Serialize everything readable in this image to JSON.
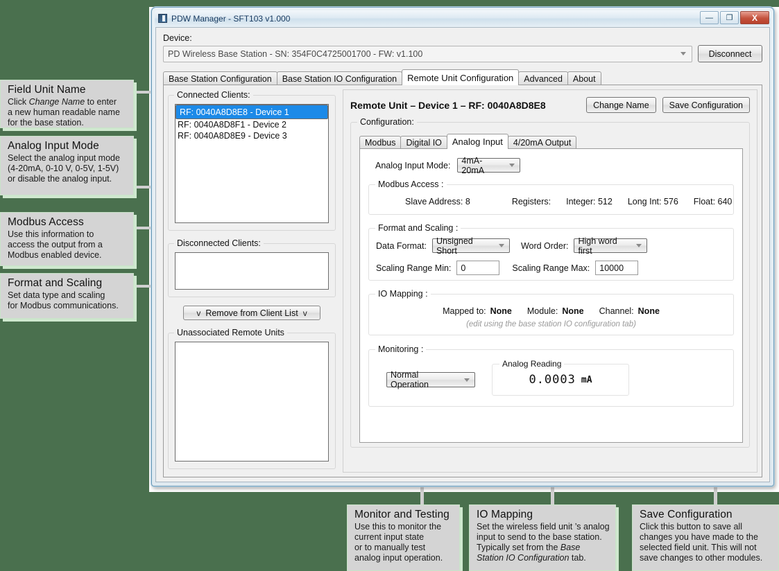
{
  "window": {
    "title": "PDW Manager - SFT103 v1.000",
    "icon": "app-icon",
    "minimize": "—",
    "maximize": "❐",
    "close": "X"
  },
  "device": {
    "label": "Device:",
    "selected": "PD Wireless Base Station - SN: 354F0C4725001700 - FW: v1.100",
    "disconnect_label": "Disconnect"
  },
  "tabs": [
    {
      "label": "Base Station Configuration",
      "active": false
    },
    {
      "label": "Base Station IO Configuration",
      "active": false
    },
    {
      "label": "Remote Unit Configuration",
      "active": true
    },
    {
      "label": "Advanced",
      "active": false
    },
    {
      "label": "About",
      "active": false
    }
  ],
  "left_panel": {
    "connected_clients": {
      "title": "Connected Clients:",
      "items": [
        {
          "label": "RF: 0040A8D8E8 - Device 1",
          "selected": true
        },
        {
          "label": "RF: 0040A8D8F1 - Device 2",
          "selected": false
        },
        {
          "label": "RF: 0040A8D8E9 - Device 3",
          "selected": false
        }
      ]
    },
    "disconnected_clients": {
      "title": "Disconnected Clients:",
      "items": []
    },
    "remove_button": {
      "left_chevron": "v",
      "label": "Remove from Client List",
      "right_chevron": "v"
    },
    "unassociated_units": {
      "title": "Unassociated Remote Units",
      "items": []
    }
  },
  "remote_unit": {
    "header_title": "Remote Unit – Device 1 – RF: 0040A8D8E8",
    "change_name_label": "Change Name",
    "save_config_label": "Save Configuration",
    "configuration_title": "Configuration:",
    "inner_tabs": [
      {
        "label": "Modbus",
        "active": false
      },
      {
        "label": "Digital IO",
        "active": false
      },
      {
        "label": "Analog Input",
        "active": true
      },
      {
        "label": "4/20mA Output",
        "active": false
      }
    ],
    "analog_input_mode": {
      "label": "Analog Input Mode:",
      "value": "4mA-20mA"
    },
    "modbus_access": {
      "title": "Modbus Access :",
      "slave_address_label": "Slave Address: 8",
      "registers_label": "Registers:",
      "integer_label": "Integer: 512",
      "long_int_label": "Long Int: 576",
      "float_label": "Float: 640"
    },
    "format_and_scaling": {
      "title": "Format and Scaling :",
      "data_format_label": "Data Format:",
      "data_format_value": "Unsigned Short",
      "word_order_label": "Word Order:",
      "word_order_value": "High word first",
      "scaling_min_label": "Scaling Range Min:",
      "scaling_min_value": "0",
      "scaling_max_label": "Scaling Range Max:",
      "scaling_max_value": "10000"
    },
    "io_mapping": {
      "title": "IO Mapping :",
      "mapped_to_label": "Mapped to:",
      "mapped_to_value": "None",
      "module_label": "Module:",
      "module_value": "None",
      "channel_label": "Channel:",
      "channel_value": "None",
      "hint": "(edit using the base station IO configuration tab)"
    },
    "monitoring": {
      "title": "Monitoring :",
      "mode_value": "Normal Operation",
      "reading_title": "Analog Reading",
      "reading_value": "0.0003",
      "reading_unit": "mA"
    }
  },
  "callouts": {
    "field_unit_name": {
      "title": "Field Unit Name",
      "line1_pre": "Click ",
      "line1_em": "Change Name",
      "line1_post": "  to enter",
      "line2": "a new human readable name",
      "line3": "for the base station."
    },
    "analog_input_mode": {
      "title": "Analog Input Mode",
      "line1": "Select the analog input mode",
      "line2": "(4-20mA, 0-10 V, 0-5V, 1-5V)",
      "line3": "or disable the analog input."
    },
    "modbus_access": {
      "title": "Modbus Access",
      "line1": "Use this information to",
      "line2": "access the output from a",
      "line3": "Modbus enabled device."
    },
    "format_and_scaling": {
      "title": "Format and Scaling",
      "line1": "Set data type and scaling",
      "line2": "for Modbus communications."
    },
    "monitor_and_testing": {
      "title": "Monitor and Testing",
      "line1": "Use this to monitor the",
      "line2": "current input state",
      "line3": "or to manually test",
      "line4": "analog input operation."
    },
    "io_mapping": {
      "title": "IO Mapping",
      "line1": "Set the wireless field unit ’s analog",
      "line2": "input to send to the base station.",
      "line3_pre": "Typically set from the ",
      "line3_em": "Base",
      "line4_em": "Station IO Configuration",
      "line4_post": "  tab."
    },
    "save_configuration": {
      "title": "Save Configuration",
      "line1": "Click this button to save all",
      "line2": "changes you have made to the",
      "line3": "selected field unit.  This will not",
      "line4": "save changes to other modules."
    }
  },
  "colors": {
    "backdrop_green": "#4a704e",
    "callout_fill": "#d4d4d4",
    "callout_edge": "#cfe8cf",
    "selection_blue": "#1c8ae8",
    "leader_gray": "#d0d0d0"
  }
}
